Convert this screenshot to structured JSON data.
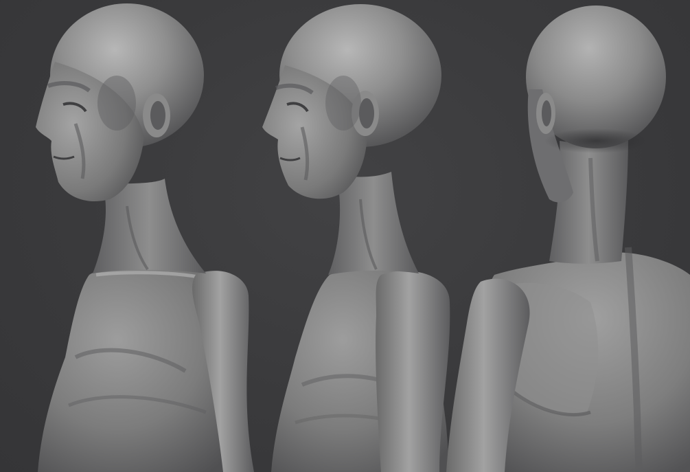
{
  "scene": {
    "background_color": "#3b3b3d",
    "model_base_color": "#8c8c8c",
    "views": [
      {
        "name": "left-three-quarter-view"
      },
      {
        "name": "left-profile-view"
      },
      {
        "name": "rear-three-quarter-view"
      }
    ]
  }
}
